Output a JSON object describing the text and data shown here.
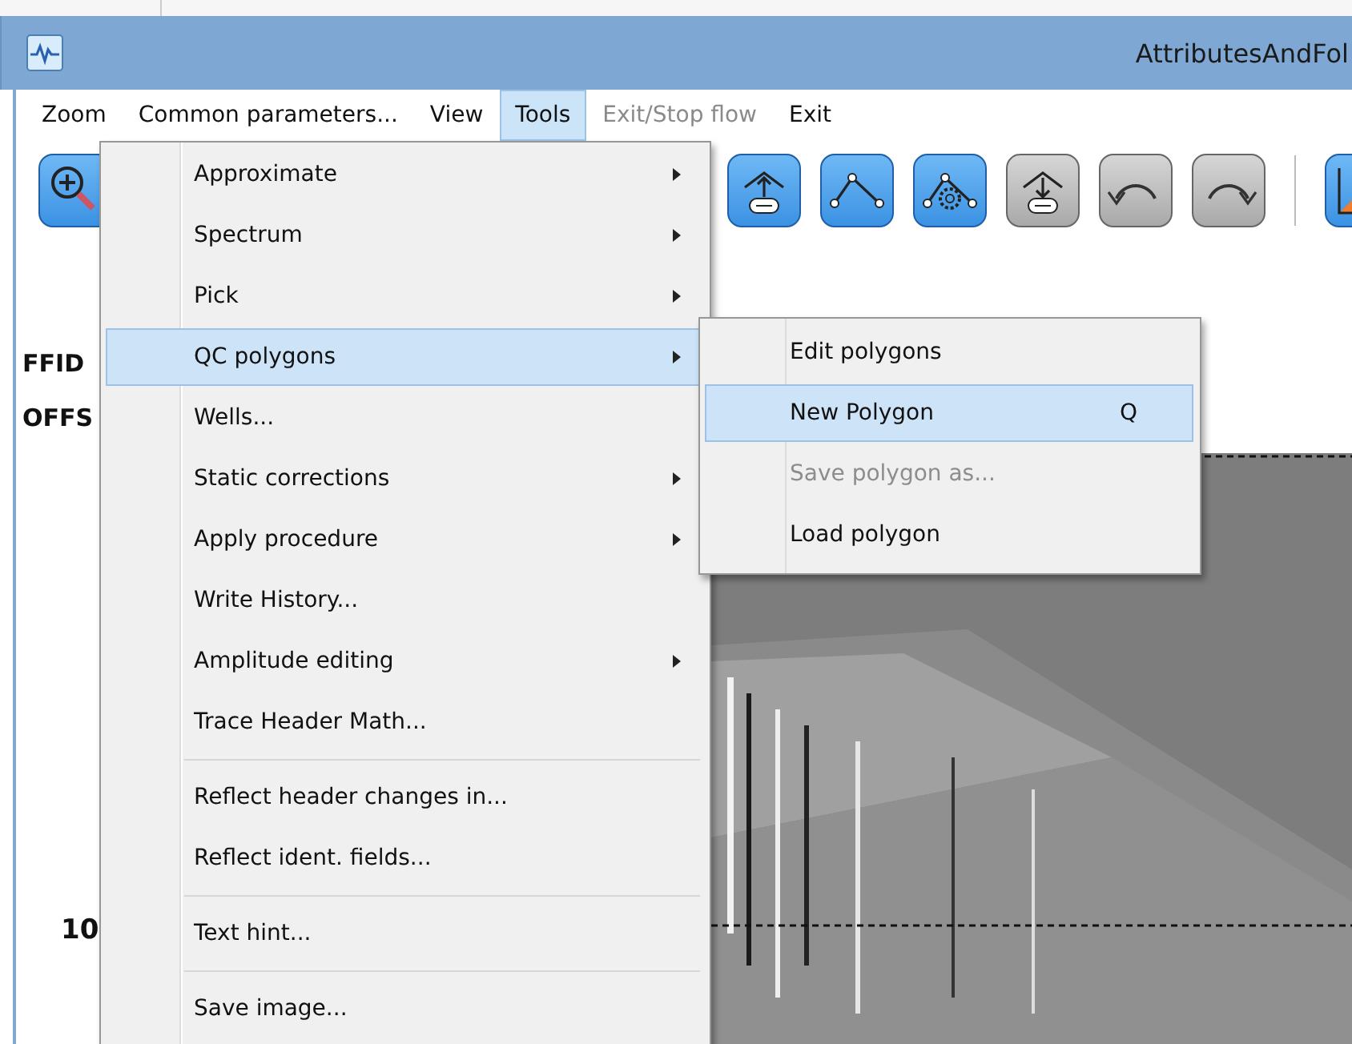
{
  "window": {
    "title": "AttributesAndFol"
  },
  "menubar": [
    {
      "label": "Zoom",
      "selected": false,
      "disabled": false
    },
    {
      "label": "Common parameters...",
      "selected": false,
      "disabled": false
    },
    {
      "label": "View",
      "selected": false,
      "disabled": false
    },
    {
      "label": "Tools",
      "selected": true,
      "disabled": false
    },
    {
      "label": "Exit/Stop flow",
      "selected": false,
      "disabled": true
    },
    {
      "label": "Exit",
      "selected": false,
      "disabled": false
    }
  ],
  "toolbar": [
    {
      "kind": "zoom",
      "disabled": false
    },
    {
      "kind": "db-up",
      "disabled": false
    },
    {
      "kind": "polyline",
      "disabled": false
    },
    {
      "kind": "polyline-gear",
      "disabled": false
    },
    {
      "kind": "db-down",
      "disabled": true
    },
    {
      "kind": "arc-left",
      "disabled": true
    },
    {
      "kind": "arc-right",
      "disabled": true
    },
    {
      "kind": "separator"
    },
    {
      "kind": "chart",
      "disabled": false
    }
  ],
  "axis_labels": [
    {
      "label": "FFID"
    },
    {
      "label": "OFFS"
    },
    {
      "label": "10"
    }
  ],
  "tools_menu": [
    {
      "kind": "item",
      "label": "Approximate",
      "submenu": true,
      "selected": false
    },
    {
      "kind": "item",
      "label": "Spectrum",
      "submenu": true,
      "selected": false
    },
    {
      "kind": "item",
      "label": "Pick",
      "submenu": true,
      "selected": false
    },
    {
      "kind": "item",
      "label": "QC polygons",
      "submenu": true,
      "selected": true
    },
    {
      "kind": "item",
      "label": "Wells...",
      "submenu": false,
      "selected": false
    },
    {
      "kind": "item",
      "label": "Static corrections",
      "submenu": true,
      "selected": false
    },
    {
      "kind": "item",
      "label": "Apply procedure",
      "submenu": true,
      "selected": false
    },
    {
      "kind": "item",
      "label": "Write History...",
      "submenu": false,
      "selected": false
    },
    {
      "kind": "item",
      "label": "Amplitude editing",
      "submenu": true,
      "selected": false
    },
    {
      "kind": "item",
      "label": "Trace Header Math...",
      "submenu": false,
      "selected": false
    },
    {
      "kind": "separator"
    },
    {
      "kind": "item",
      "label": "Reflect header changes in...",
      "submenu": false,
      "selected": false
    },
    {
      "kind": "item",
      "label": "Reflect ident. fields...",
      "submenu": false,
      "selected": false
    },
    {
      "kind": "separator"
    },
    {
      "kind": "item",
      "label": "Text hint...",
      "submenu": false,
      "selected": false
    },
    {
      "kind": "separator"
    },
    {
      "kind": "item",
      "label": "Save image...",
      "submenu": false,
      "selected": false
    }
  ],
  "qc_polygons_submenu": [
    {
      "label": "Edit polygons",
      "selected": false,
      "disabled": false
    },
    {
      "label": "New Polygon",
      "shortcut": "Q",
      "selected": true,
      "disabled": false
    },
    {
      "label": "Save polygon as...",
      "selected": false,
      "disabled": true
    },
    {
      "label": "Load polygon",
      "selected": false,
      "disabled": false
    }
  ]
}
